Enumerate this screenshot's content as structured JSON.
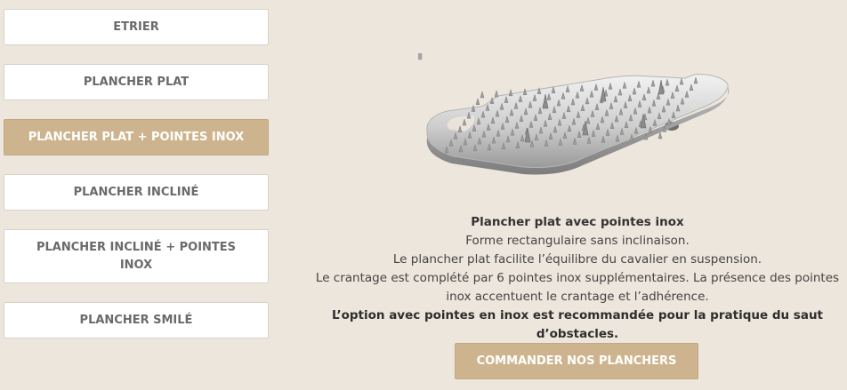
{
  "menu": {
    "items": [
      {
        "label": "ETRIER"
      },
      {
        "label": "PLANCHER PLAT"
      },
      {
        "label": "PLANCHER PLAT + POINTES INOX"
      },
      {
        "label": "PLANCHER INCLINÉ"
      },
      {
        "label": "PLANCHER INCLINÉ + POINTES INOX"
      },
      {
        "label": "PLANCHER SMILÉ"
      }
    ],
    "active_index": 2
  },
  "product": {
    "image_icon": "stirrup-tread-with-spikes",
    "title": "Plancher plat avec pointes inox",
    "line1": "Forme rectangulaire sans inclinaison.",
    "line2": "Le plancher plat facilite l’équilibre du cavalier en suspension.",
    "line3": "Le crantage est complété par 6 pointes inox supplémentaires. La présence des pointes inox accentuent le crantage et l’adhérence.",
    "recommendation": "L’option avec pointes en inox est recommandée pour la pratique du saut d’obstacles."
  },
  "order_button": {
    "label": "COMMANDER NOS PLANCHERS"
  },
  "colors": {
    "background": "#ede6dc",
    "accent": "#cdb48e",
    "button_text": "#6a6a6a"
  }
}
